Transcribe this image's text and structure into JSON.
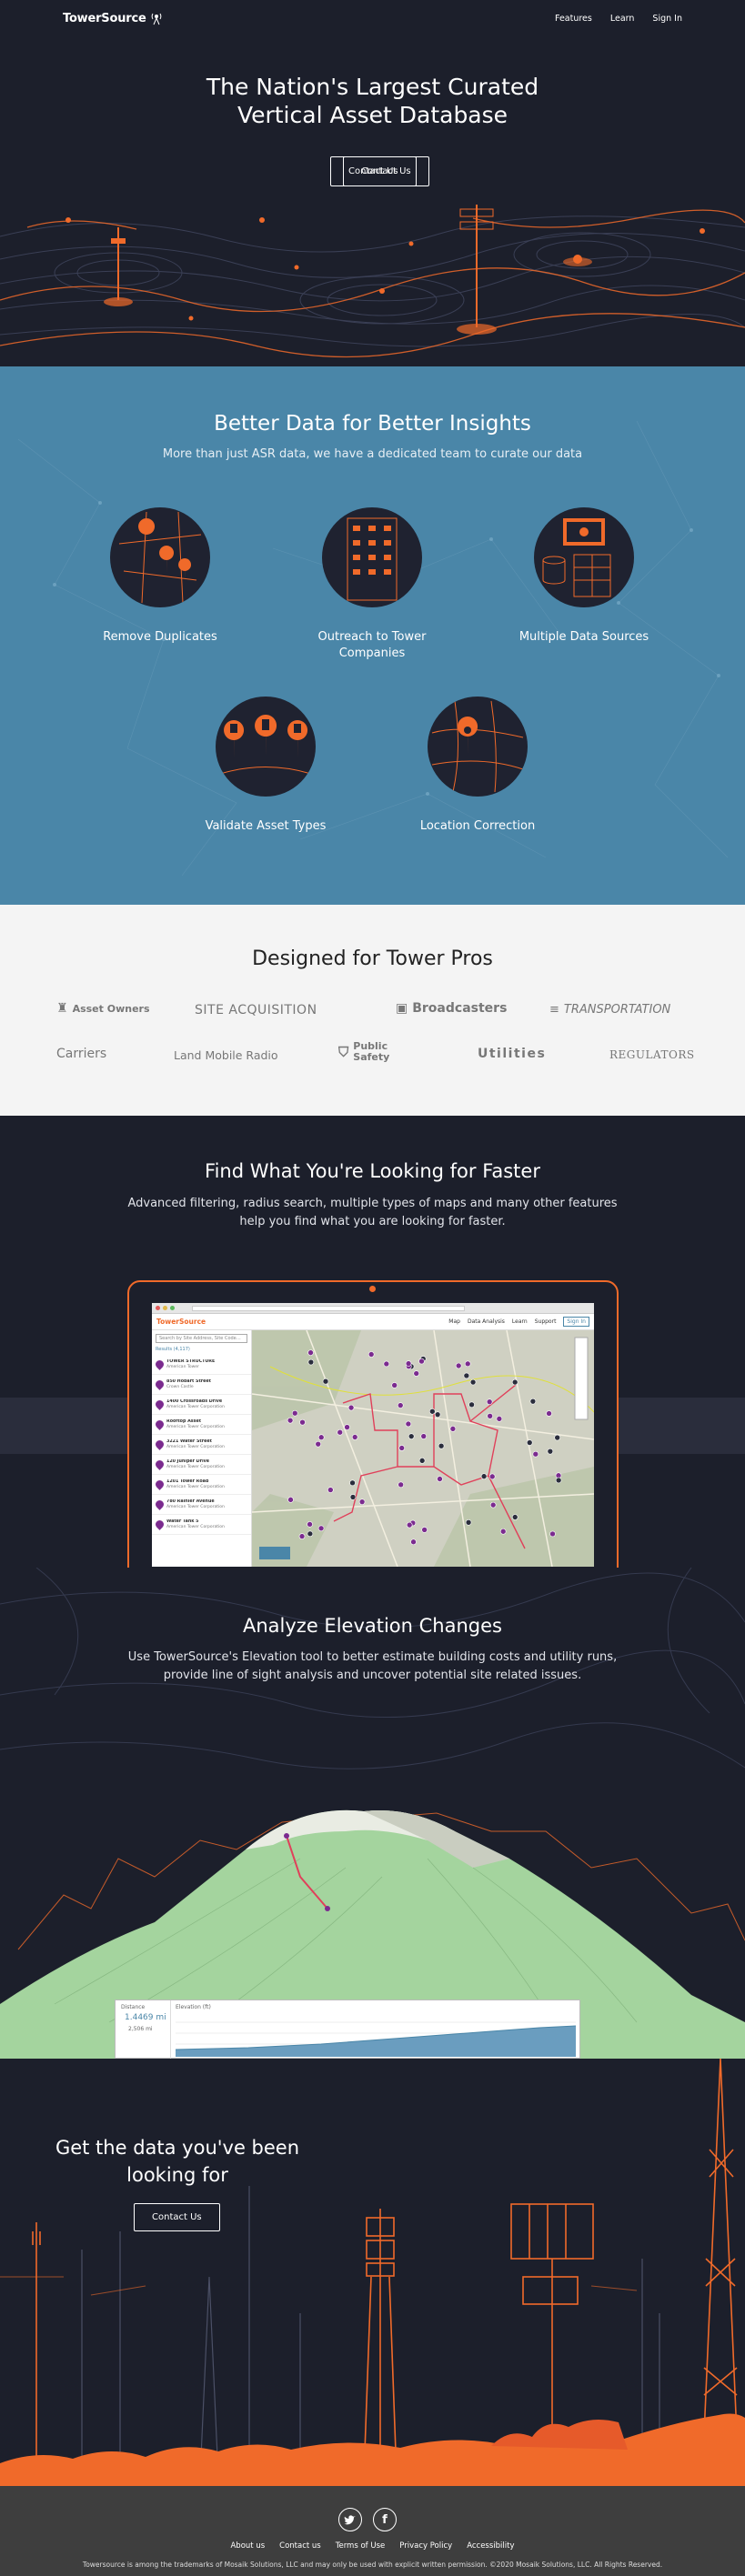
{
  "nav": {
    "brand": "TowerSource",
    "links": [
      "Features",
      "Learn",
      "Sign In"
    ],
    "contact": "Contact Us"
  },
  "hero": {
    "title_line1": "The Nation's Largest Curated",
    "title_line2": "Vertical Asset Database",
    "cta": "Contact Us"
  },
  "insights": {
    "title": "Better Data for Better Insights",
    "subtitle": "More than just ASR data, we have a dedicated team to curate our data",
    "features": [
      {
        "label": "Remove Duplicates",
        "icon": "map-pins-icon"
      },
      {
        "label": "Outreach to Tower Companies",
        "icon": "building-icon"
      },
      {
        "label": "Multiple Data Sources",
        "icon": "database-icon"
      },
      {
        "label": "Validate Asset Types",
        "icon": "asset-pins-icon"
      },
      {
        "label": "Location Correction",
        "icon": "location-pin-icon"
      }
    ]
  },
  "pros": {
    "title": "Designed for Tower Pros",
    "row1": [
      "Asset Owners",
      "SITE ACQUISITION",
      "Broadcasters",
      "TRANSPORTATION"
    ],
    "row2": [
      "Carriers",
      "Land Mobile Radio",
      "Public Safety",
      "Utilities",
      "REGULATORS"
    ]
  },
  "find": {
    "title": "Find What You're Looking for Faster",
    "body": "Advanced filtering, radius search, multiple types of maps and many other features help you find what you are looking for faster.",
    "app": {
      "brand": "TowerSource",
      "search_placeholder": "Search by Site Address, Site Code…",
      "results_label": "Results (4,117)",
      "map_menu": [
        "Map",
        "Data Analysis",
        "Learn",
        "Support"
      ],
      "sign_in": "Sign In",
      "results": [
        {
          "title": "TOWER STRUCTURE",
          "sub": "American Tower"
        },
        {
          "title": "850 Hobart Street",
          "sub": "Crown Castle"
        },
        {
          "title": "1400 Crossroads Drive",
          "sub": "American Tower Corporation"
        },
        {
          "title": "Rooftop Asset",
          "sub": "American Tower Corporation"
        },
        {
          "title": "3221 Water Street",
          "sub": "American Tower Corporation"
        },
        {
          "title": "120 Juniper Drive",
          "sub": "American Tower Corporation"
        },
        {
          "title": "1201 Tower Road",
          "sub": "American Tower Corporation"
        },
        {
          "title": "780 Rainier Avenue",
          "sub": "American Tower Corporation"
        },
        {
          "title": "Water Tank 5",
          "sub": "American Tower Corporation"
        }
      ]
    }
  },
  "elevation": {
    "title": "Analyze Elevation Changes",
    "body": "Use TowerSource's Elevation tool to better estimate building costs and utility runs, provide line of sight analysis and uncover potential site related issues.",
    "panel": {
      "label": "Distance",
      "value": "1.4469 mi",
      "secondary": "2,506 mi",
      "chart_title": "Elevation (ft)"
    }
  },
  "cta": {
    "title": "Get the data you've been looking for",
    "button": "Contact Us"
  },
  "footer": {
    "links": [
      "About us",
      "Contact us",
      "Terms of Use",
      "Privacy Policy",
      "Accessibility"
    ],
    "copyright": "Towersource is among the trademarks of Mosaik Solutions, LLC and may only be used with explicit written permission. ©2020 Mosaik Solutions, LLC. All Rights Reserved.",
    "social": [
      "twitter-icon",
      "facebook-icon"
    ]
  },
  "colors": {
    "accent": "#f06a2a",
    "navy": "#1c1f2b",
    "blue": "#4a86a8",
    "pin": "#7b2b8f"
  }
}
